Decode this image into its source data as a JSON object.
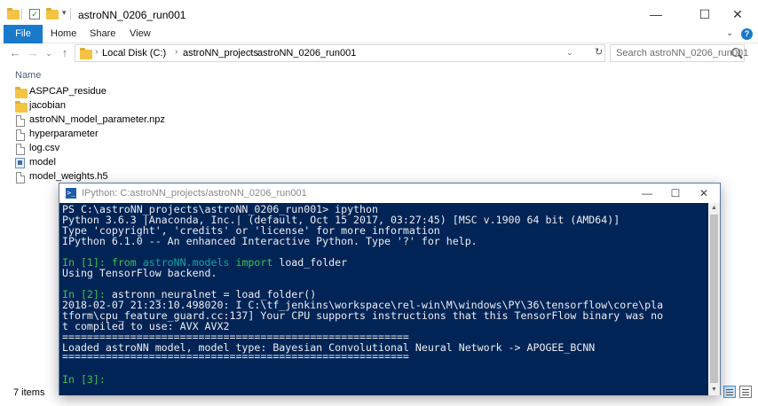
{
  "explorer": {
    "title": "astroNN_0206_run001",
    "window_buttons": {
      "minimize": "—",
      "maximize": "☐",
      "close": "✕"
    },
    "ribbon_tabs": [
      "File",
      "Home",
      "Share",
      "View"
    ],
    "ribbon_expand": "⌄",
    "help": "?",
    "nav": {
      "back": "←",
      "forward": "→",
      "recent": "⌄",
      "up": "↑"
    },
    "breadcrumbs": [
      "Local Disk (C:)",
      "astroNN_projects",
      "astroNN_0206_run001"
    ],
    "search_placeholder": "Search astroNN_0206_run001",
    "column_header": "Name",
    "files": [
      {
        "name": "ASPCAP_residue",
        "icon": "folder-icon"
      },
      {
        "name": "jacobian",
        "icon": "folder-icon"
      },
      {
        "name": "astroNN_model_parameter.npz",
        "icon": "document-icon"
      },
      {
        "name": "hyperparameter",
        "icon": "document-icon"
      },
      {
        "name": "log.csv",
        "icon": "document-icon"
      },
      {
        "name": "model",
        "icon": "python-file-icon"
      },
      {
        "name": "model_weights.h5",
        "icon": "document-icon"
      }
    ],
    "status_count": "7 items"
  },
  "powershell": {
    "title": "IPython: C:astroNN_projects/astroNN_0206_run001",
    "logo": ">_",
    "window_buttons": {
      "minimize": "—",
      "maximize": "☐",
      "close": "✕"
    },
    "lines": [
      "PS C:\\astroNN_projects\\astroNN_0206_run001> ipython",
      "Python 3.6.3 |Anaconda, Inc.| (default, Oct 15 2017, 03:27:45) [MSC v.1900 64 bit (AMD64)]",
      "Type 'copyright', 'credits' or 'license' for more information",
      "IPython 6.1.0 -- An enhanced Interactive Python. Type '?' for help.",
      "",
      "In [1]: from astroNN.models import load_folder",
      "Using TensorFlow backend.",
      "",
      "In [2]: astronn_neuralnet = load_folder()",
      "2018-02-07 21:23:10.498020: I C:\\tf_jenkins\\workspace\\rel-win\\M\\windows\\PY\\36\\tensorflow\\core\\pla",
      "tform\\cpu_feature_guard.cc:137] Your CPU supports instructions that this TensorFlow binary was no",
      "t compiled to use: AVX AVX2",
      "========================================================",
      "Loaded astroNN model, model type: Bayesian Convolutional Neural Network -> APOGEE_BCNN",
      "========================================================",
      "",
      "In [3]: "
    ],
    "prompt_1": "In [1]: ",
    "cmd_1_from": "from",
    "cmd_1_module": "astroNN.models",
    "cmd_1_import": "import",
    "cmd_1_name": " load_folder",
    "prompt_2": "In [2]: ",
    "cmd_2": "astronn_neuralnet = load_folder()",
    "prompt_3": "In [3]: "
  },
  "colors": {
    "console_bg": "#012456",
    "console_text": "#eeedf0",
    "prompt_green": "#3ec24a",
    "keyword_teal": "#14a5a0",
    "file_tab_blue": "#1979ca",
    "folder_yellow": "#f3c443"
  }
}
